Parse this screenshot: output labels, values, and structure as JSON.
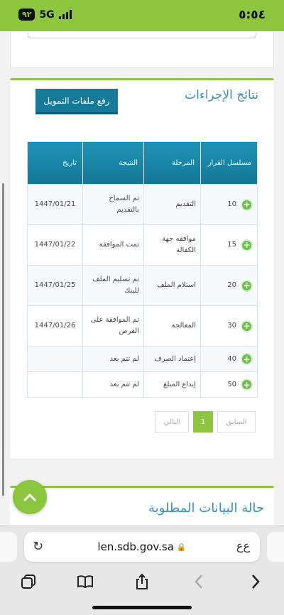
{
  "status_bar": {
    "time": "٥:٥٤",
    "network": "5G",
    "battery": "٩٢"
  },
  "results_card": {
    "title": "نتائج الإجراءات",
    "upload_button": "رفع ملفات التمويل",
    "table": {
      "headers": [
        "مسلسل القرار",
        "المرحلة",
        "النتيجة",
        "تاريخ"
      ],
      "rows": [
        {
          "seq": "10",
          "stage": "التقديم",
          "result": "تم السماح بالتقديم",
          "date": "1447/01/21"
        },
        {
          "seq": "15",
          "stage": "موافقه جهة الكفالة",
          "result": "تمت الموافقة",
          "date": "1447/01/22"
        },
        {
          "seq": "20",
          "stage": "استلام الملف",
          "result": "تم تسليم الملف للبنك",
          "date": "1447/01/25"
        },
        {
          "seq": "30",
          "stage": "المعالجة",
          "result": "تم الموافقة على القرض",
          "date": "1447/01/26"
        },
        {
          "seq": "40",
          "stage": "إعتماد الصرف",
          "result": "لم تتم بعد",
          "date": ""
        },
        {
          "seq": "50",
          "stage": "إيداع المبلغ",
          "result": "لم تتم بعد",
          "date": ""
        }
      ]
    },
    "pagination": {
      "prev": "السابق",
      "current": "1",
      "next": "التالي"
    }
  },
  "required_data_card": {
    "title": "حالة البيانات المطلوبة"
  },
  "safari": {
    "url": "len.sdb.gov.sa",
    "text_size": "ﻉﻉ"
  },
  "colors": {
    "accent_green": "#8cc63f",
    "header_blue": "#157a9a",
    "title_blue": "#3a8fb7"
  }
}
